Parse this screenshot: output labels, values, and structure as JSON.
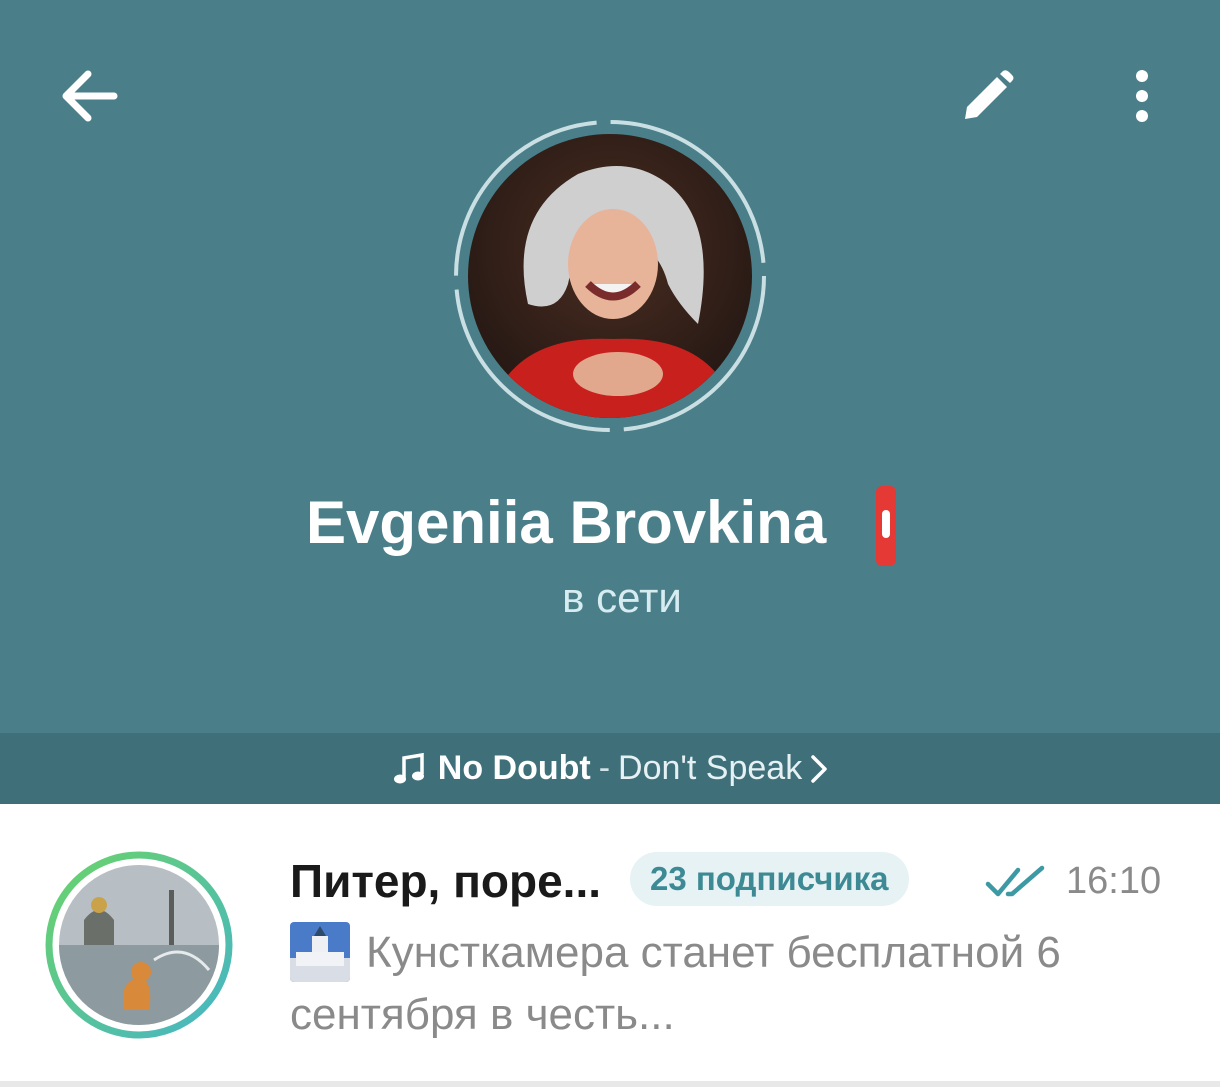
{
  "header": {
    "back_icon": "arrow-left-icon",
    "edit_icon": "pencil-icon",
    "more_icon": "more-vertical-icon",
    "background_color": "#4a7f89"
  },
  "profile": {
    "name": "Evgeniia Brovkina",
    "status": "в сети",
    "emoji_badge": "red-emoji-badge"
  },
  "music": {
    "artist": "No Doubt",
    "separator": "-",
    "song": "Don't Speak",
    "note_icon": "music-note-icon",
    "chevron_icon": "chevron-right-icon"
  },
  "chat": {
    "title": "Питер, поре...",
    "subscribers": "23 подписчика",
    "time": "16:10",
    "message": "Кунсткамера станет бесплатной 6 сентября в честь...",
    "read_status_icon": "double-check-icon"
  },
  "colors": {
    "header_bg": "#4a7f89",
    "music_bar_bg": "#3f707a",
    "accent": "#3d8a95"
  }
}
